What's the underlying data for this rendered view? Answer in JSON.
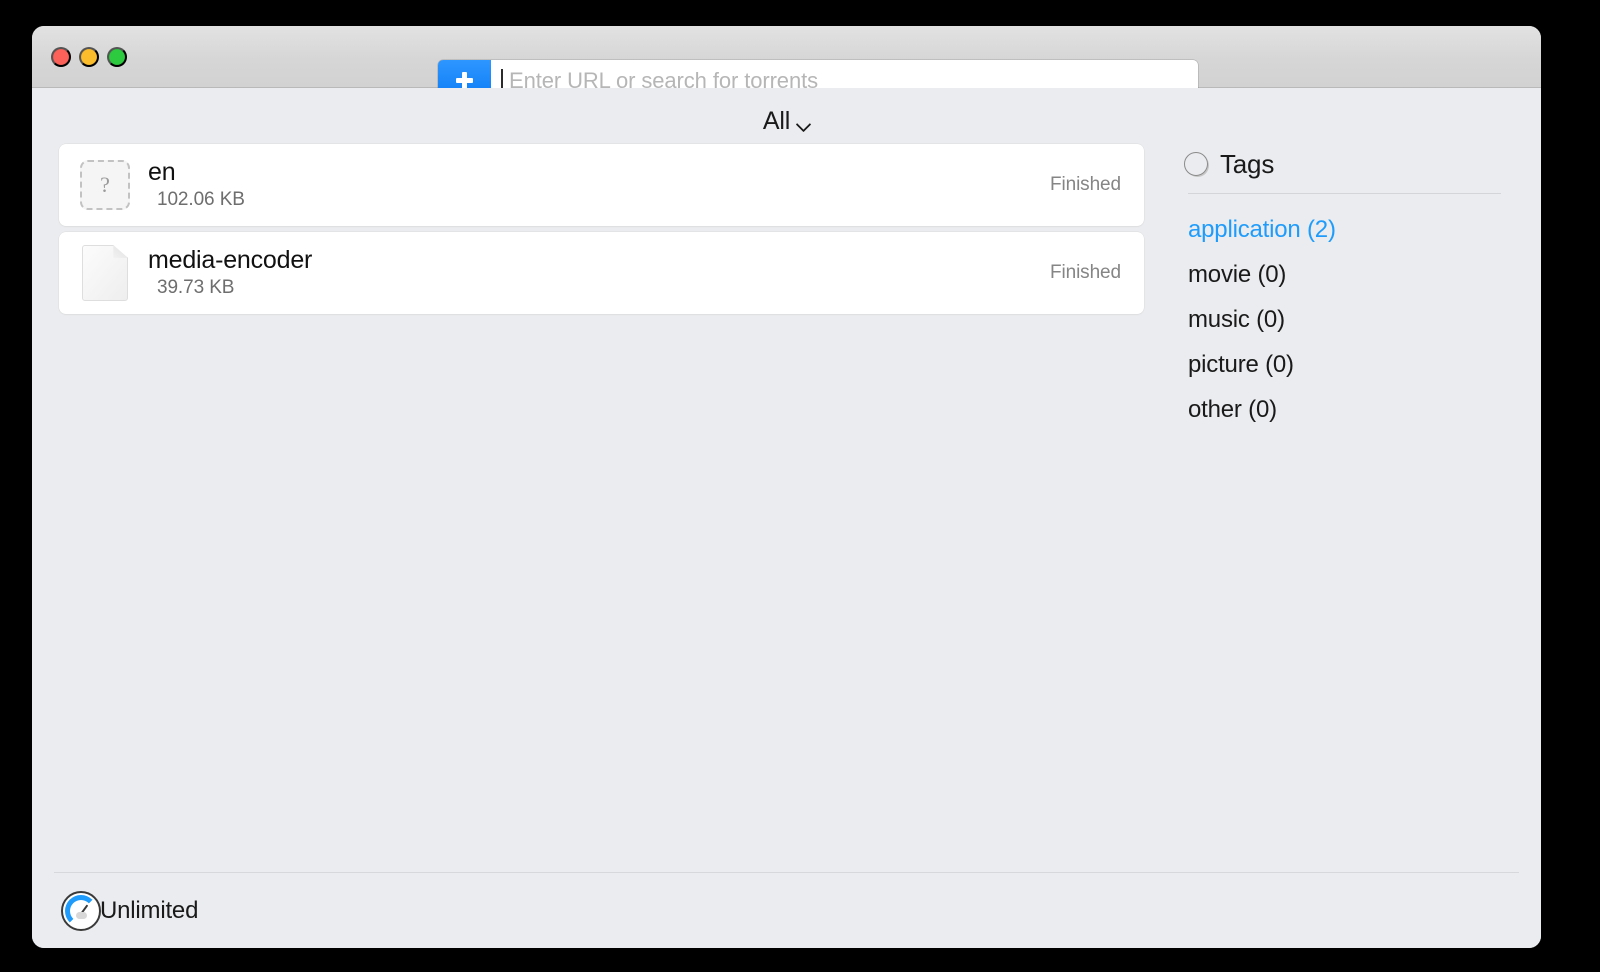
{
  "window": {
    "traffic_lights": [
      {
        "name": "close",
        "color": "#fb6158"
      },
      {
        "name": "minimize",
        "color": "#fcbd2d"
      },
      {
        "name": "zoom",
        "color": "#2dc93f"
      }
    ]
  },
  "toolbar": {
    "add_button_icon": "plus-icon",
    "url_input": {
      "value": "",
      "placeholder": "Enter URL or search for torrents"
    }
  },
  "filter": {
    "selected": "All",
    "chevron_icon": "chevron-down-icon"
  },
  "torrents": [
    {
      "name": "en",
      "size": "102.06 KB",
      "status": "Finished",
      "icon": "unknown-file-icon",
      "icon_glyph": "?"
    },
    {
      "name": "media-encoder",
      "size": "39.73 KB",
      "status": "Finished",
      "icon": "document-file-icon",
      "icon_glyph": ""
    }
  ],
  "tags": {
    "header_icon": "circle-outline-icon",
    "title": "Tags",
    "items": [
      {
        "label": "application (2)",
        "selected": true
      },
      {
        "label": "movie (0)",
        "selected": false
      },
      {
        "label": "music (0)",
        "selected": false
      },
      {
        "label": "picture (0)",
        "selected": false
      },
      {
        "label": "other (0)",
        "selected": false
      }
    ]
  },
  "statusbar": {
    "speed_icon": "speedometer-icon",
    "speed_label": "Unlimited"
  },
  "colors": {
    "accent": "#1f9cfb",
    "window_bg": "#eaecef",
    "toolbar_bg": "#d6d6d6",
    "row_bg": "#ffffff",
    "desktop_bg": "#000000"
  }
}
